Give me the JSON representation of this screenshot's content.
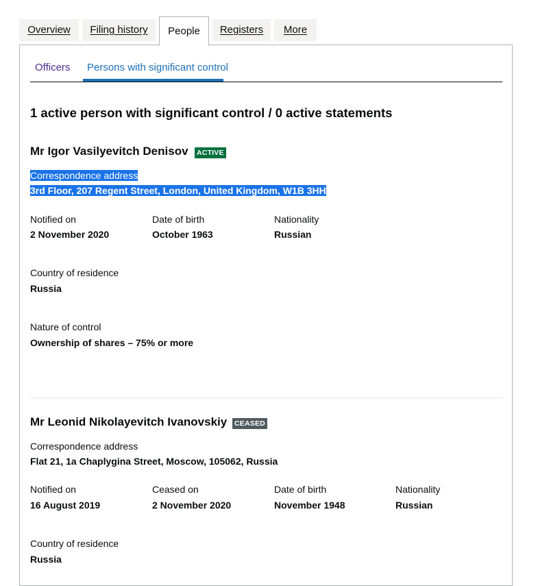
{
  "tabs": [
    "Overview",
    "Filing history",
    "People",
    "Registers",
    "More"
  ],
  "subtabs": [
    "Officers",
    "Persons with significant control"
  ],
  "heading": "1 active person with significant control / 0 active statements",
  "colors": {
    "active_badge": "#00703c",
    "ceased_badge": "#505a5f",
    "link": "#1d70b8",
    "visited": "#4c2c92",
    "selection": "#1a73e8"
  },
  "persons": [
    {
      "name": "Mr Igor Vasilyevitch Denisov",
      "status": "ACTIVE",
      "address_label": "Correspondence address",
      "address": "3rd Floor, 207 Regent Street, London, United Kingdom, W1B 3HH",
      "notified_label": "Notified on",
      "notified": "2 November 2020",
      "dob_label": "Date of birth",
      "dob": "October 1963",
      "nationality_label": "Nationality",
      "nationality": "Russian",
      "residence_label": "Country of residence",
      "residence": "Russia",
      "control_label": "Nature of control",
      "control": "Ownership of shares – 75% or more"
    },
    {
      "name": "Mr Leonid Nikolayevitch Ivanovskiy",
      "status": "CEASED",
      "address_label": "Correspondence address",
      "address": "Flat 21, 1a Chaplygina Street, Moscow, 105062, Russia",
      "notified_label": "Notified on",
      "notified": "16 August 2019",
      "ceased_label": "Ceased on",
      "ceased": "2 November 2020",
      "dob_label": "Date of birth",
      "dob": "November 1948",
      "nationality_label": "Nationality",
      "nationality": "Russian",
      "residence_label": "Country of residence",
      "residence": "Russia"
    }
  ]
}
